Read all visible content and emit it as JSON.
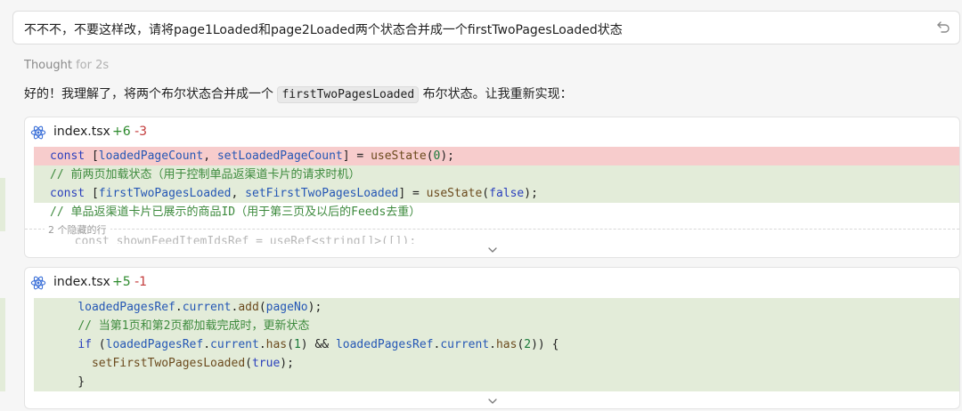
{
  "user_message": "不不不，不要这样改，请将page1Loaded和page2Loaded两个状态合并成一个firstTwoPagesLoaded状态",
  "thought": {
    "label": "Thought",
    "duration": "for 2s"
  },
  "reply": {
    "before": "好的！我理解了，将两个布尔状态合并成一个 ",
    "code": "firstTwoPagesLoaded",
    "after": " 布尔状态。让我重新实现："
  },
  "diff1": {
    "filename": "index.tsx",
    "added": "+6",
    "removed": "-3",
    "hidden_label": "2 个隐藏的行"
  },
  "diff2": {
    "filename": "index.tsx",
    "added": "+5",
    "removed": "-1"
  },
  "icons": {
    "file_icon": "react-icon",
    "expand_icon": "chevron-down-icon",
    "undo_icon": "undo-icon"
  },
  "colors": {
    "removed_bg": "#f7cccc",
    "added_bg": "#e3ecd9",
    "keyword": "#2a3fbd",
    "comment": "#3d8a3d"
  }
}
